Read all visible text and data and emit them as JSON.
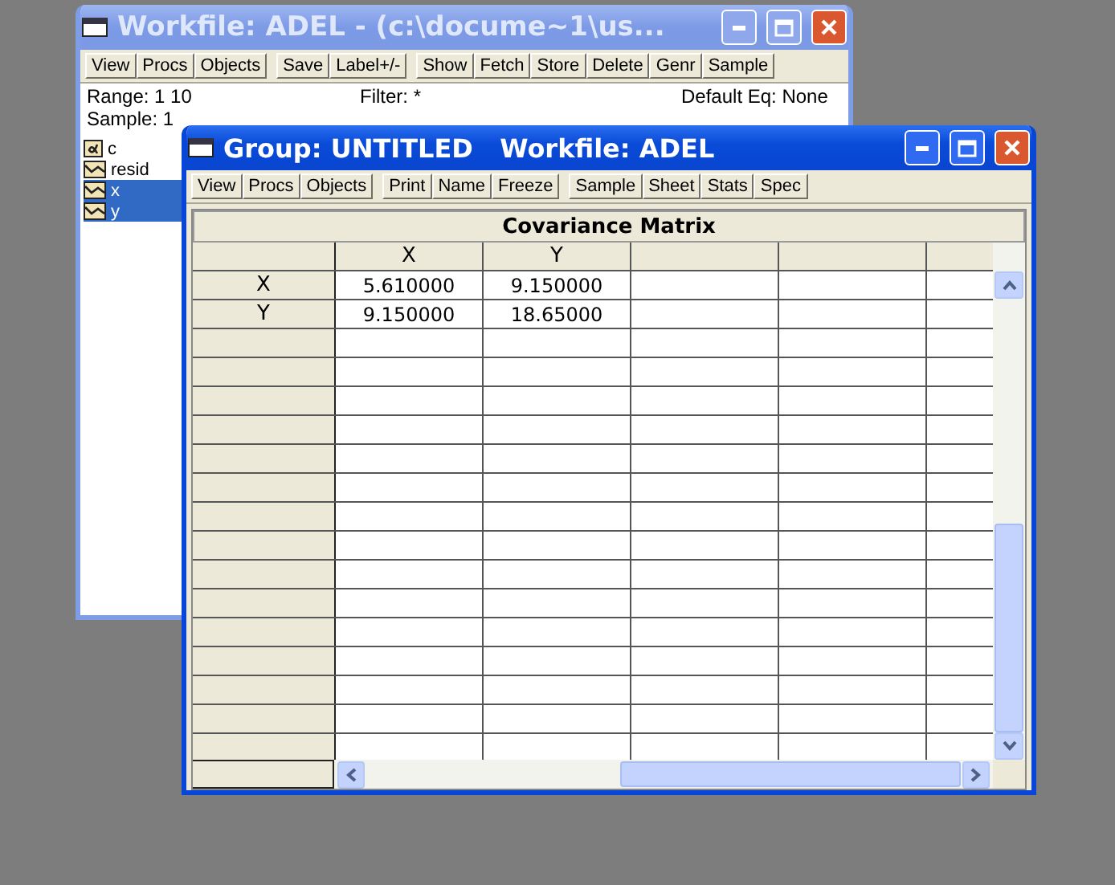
{
  "back_window": {
    "title": "Workfile: ADEL - (c:\\docume~1\\us...",
    "toolbar": [
      [
        "View",
        "Procs",
        "Objects"
      ],
      [
        "Save",
        "Label+/-"
      ],
      [
        "Show",
        "Fetch",
        "Store",
        "Delete",
        "Genr",
        "Sample"
      ]
    ],
    "range_label": "Range:",
    "range_value": "1 10",
    "filter": "Filter: *",
    "default_eq": "Default Eq: None",
    "sample": "Sample: 1",
    "objects": [
      {
        "name": "c",
        "kind": "coef",
        "selected": false
      },
      {
        "name": "resid",
        "kind": "series",
        "selected": false
      },
      {
        "name": "x",
        "kind": "series",
        "selected": true
      },
      {
        "name": "y",
        "kind": "series",
        "selected": true
      }
    ]
  },
  "front_window": {
    "title": "Group: UNTITLED   Workfile: ADEL",
    "toolbar": [
      [
        "View",
        "Procs",
        "Objects"
      ],
      [
        "Print",
        "Name",
        "Freeze"
      ],
      [
        "Sample",
        "Sheet",
        "Stats",
        "Spec"
      ]
    ],
    "table": {
      "title": "Covariance Matrix",
      "columns": [
        "X",
        "Y"
      ],
      "rows": [
        {
          "label": "X",
          "cells": [
            "5.610000",
            "9.150000"
          ]
        },
        {
          "label": "Y",
          "cells": [
            "9.150000",
            "18.65000"
          ]
        }
      ]
    }
  }
}
